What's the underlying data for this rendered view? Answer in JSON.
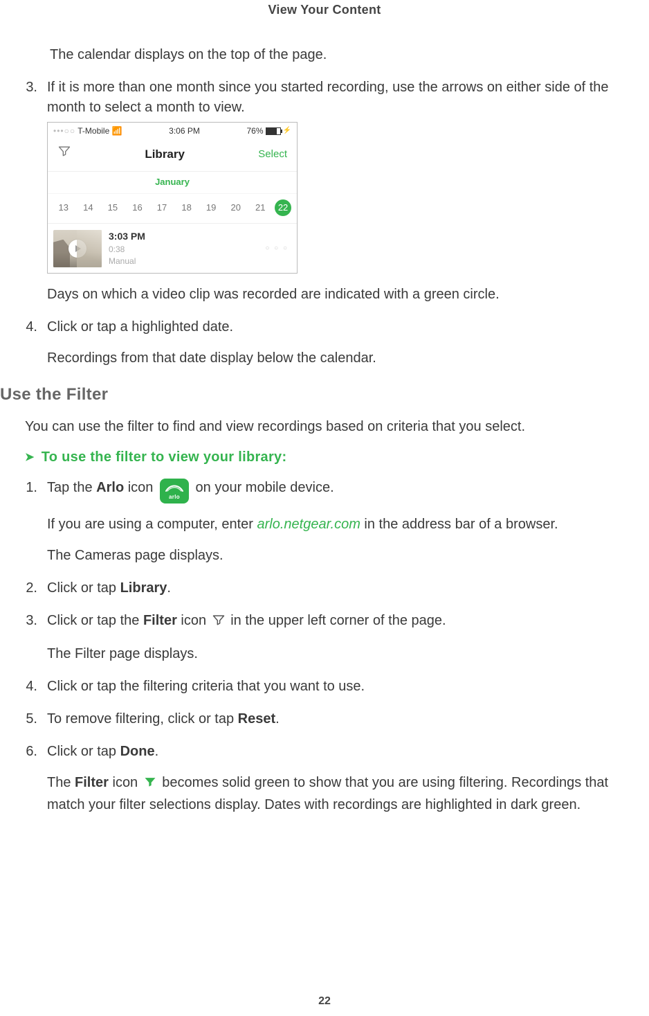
{
  "header": "View Your Content",
  "intro_para": "The calendar displays on the top of the page.",
  "step3": {
    "num": "3.",
    "text": "If it is more than one month since you started recording, use the arrows on either side of the month to select a month to view.",
    "after": "Days on which a video clip was recorded are indicated with a green circle."
  },
  "phone": {
    "carrier": "T-Mobile",
    "time": "3:06 PM",
    "battery": "76%",
    "title": "Library",
    "select": "Select",
    "month": "January",
    "days": [
      "13",
      "14",
      "15",
      "16",
      "17",
      "18",
      "19",
      "20",
      "21",
      "22"
    ],
    "active_day_index": 9,
    "clip_time": "3:03 PM",
    "clip_dur": "0:38",
    "clip_src": "Manual"
  },
  "step4": {
    "num": "4.",
    "text": "Click or tap a highlighted date.",
    "sub": "Recordings from that date display below the calendar."
  },
  "section_h": "Use the Filter",
  "filter_intro": "You can use the filter to find and view recordings based on criteria that you select.",
  "task": "To use the filter to view your library:",
  "f1": {
    "num": "1.",
    "pre": "Tap the ",
    "bold1": "Arlo",
    "mid": " icon ",
    "post": " on your mobile device.",
    "sub1a": "If you are using a computer, enter ",
    "sub1_link": "arlo.netgear.com",
    "sub1b": " in the address bar of a browser.",
    "sub2": "The Cameras page displays."
  },
  "f2": {
    "num": "2.",
    "pre": "Click or tap ",
    "bold": "Library",
    "post": "."
  },
  "f3": {
    "num": "3.",
    "pre": "Click or tap the ",
    "bold": "Filter",
    "mid": " icon ",
    "post": " in the upper left corner of the page.",
    "sub": "The Filter page displays."
  },
  "f4": {
    "num": "4.",
    "text": "Click or tap the filtering criteria that you want to use."
  },
  "f5": {
    "num": "5.",
    "pre": "To remove filtering, click or tap ",
    "bold": "Reset",
    "post": "."
  },
  "f6": {
    "num": "6.",
    "pre": "Click or tap ",
    "bold": "Done",
    "post": ".",
    "sub_pre": "The ",
    "sub_bold": "Filter",
    "sub_mid": " icon ",
    "sub_post": " becomes solid green to show that you are using filtering. Recordings that match your filter selections display. Dates with recordings are highlighted in dark green."
  },
  "page_num": "22"
}
